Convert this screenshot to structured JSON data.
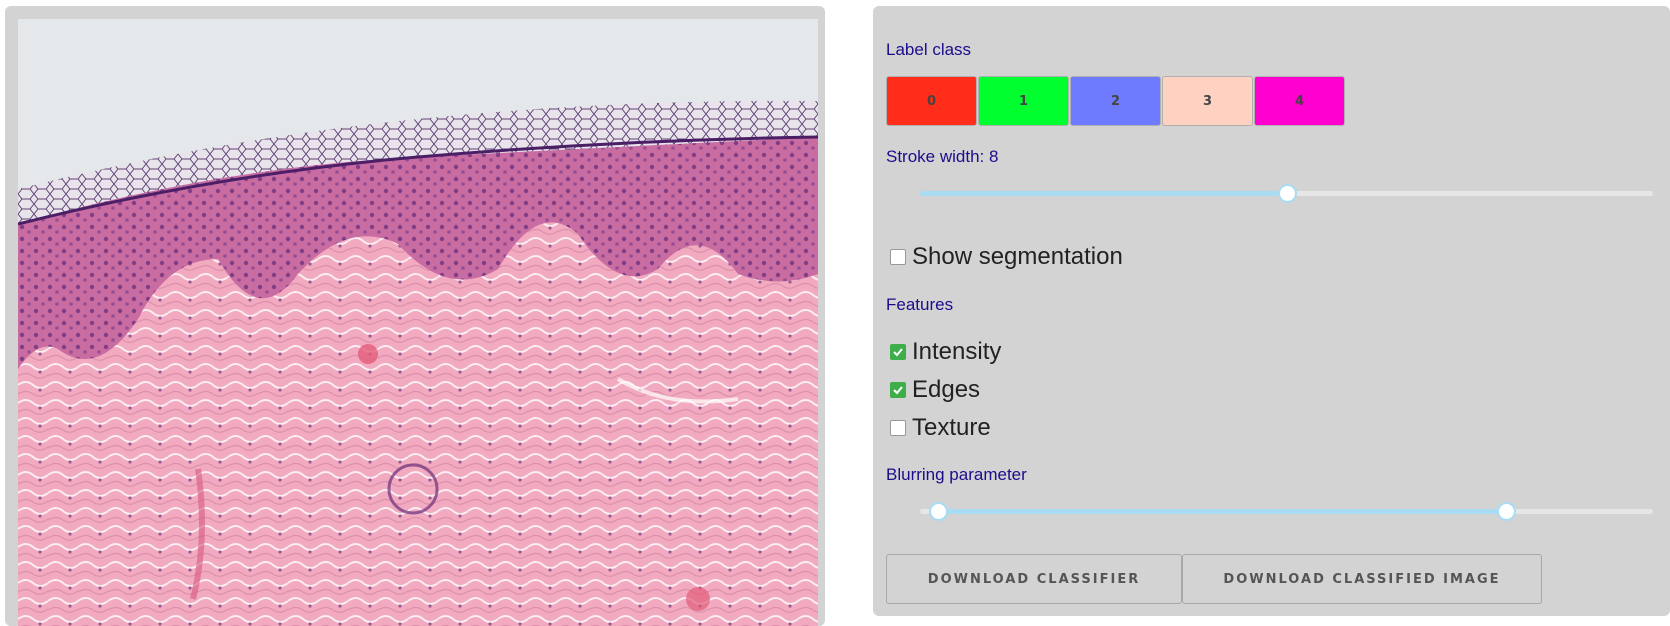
{
  "label_class": {
    "title": "Label class",
    "buttons": [
      {
        "label": "0",
        "color": "#ff2d1a"
      },
      {
        "label": "1",
        "color": "#00ff2e"
      },
      {
        "label": "2",
        "color": "#6e7bff"
      },
      {
        "label": "3",
        "color": "#ffd1c0"
      },
      {
        "label": "4",
        "color": "#ff00d0"
      }
    ]
  },
  "stroke": {
    "label": "Stroke width: 8",
    "value": 8,
    "level": 0.5
  },
  "segmentation": {
    "label": "Show segmentation",
    "checked": false
  },
  "features": {
    "title": "Features",
    "items": [
      {
        "label": "Intensity",
        "checked": true
      },
      {
        "label": "Edges",
        "checked": true
      },
      {
        "label": "Texture",
        "checked": false
      }
    ]
  },
  "blurring": {
    "title": "Blurring parameter",
    "range_low": 0.025,
    "range_high": 0.8
  },
  "downloads": {
    "classifier": "DOWNLOAD CLASSIFIER",
    "classified_image": "DOWNLOAD CLASSIFIED IMAGE"
  },
  "colors": {
    "panel_bg": "#d3d3d3",
    "label_text": "#1a0d8c",
    "slider_fill": "#a8dcf2",
    "checkbox_on": "#3eae4a"
  }
}
